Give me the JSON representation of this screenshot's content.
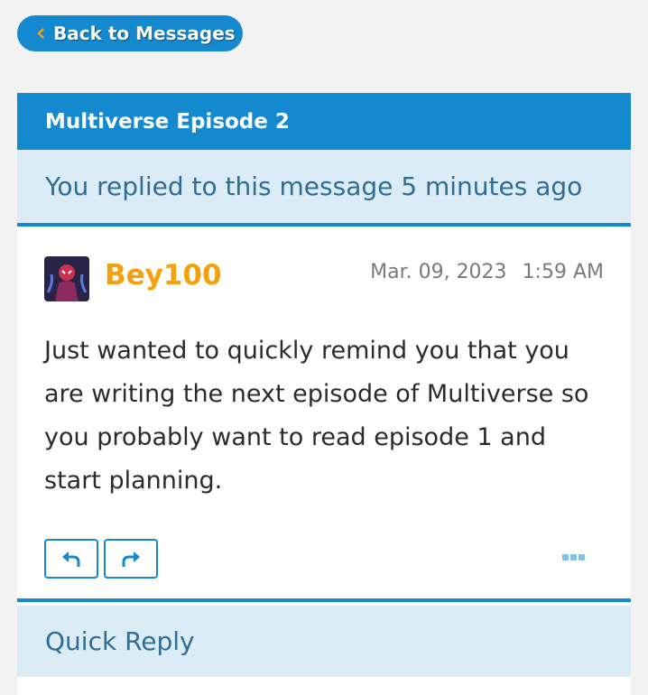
{
  "nav": {
    "back_label": "Back to Messages"
  },
  "conversation": {
    "title": "Multiverse Episode 2",
    "notice": "You replied to this message 5 minutes ago"
  },
  "message": {
    "author": "Bey100",
    "date": "Mar. 09, 2023",
    "time": "1:59 AM",
    "body": "Just wanted to quickly remind you that you are writing the next episode of Multiverse so you probably want to read episode 1 and start planning."
  },
  "actions": {
    "reply_icon": "reply-icon",
    "forward_icon": "forward-icon",
    "more_icon": "more-icon"
  },
  "quick_reply": {
    "label": "Quick Reply"
  },
  "colors": {
    "accent": "#1589d0",
    "notice_bg": "#dbecf6",
    "author": "#f3a10f"
  }
}
